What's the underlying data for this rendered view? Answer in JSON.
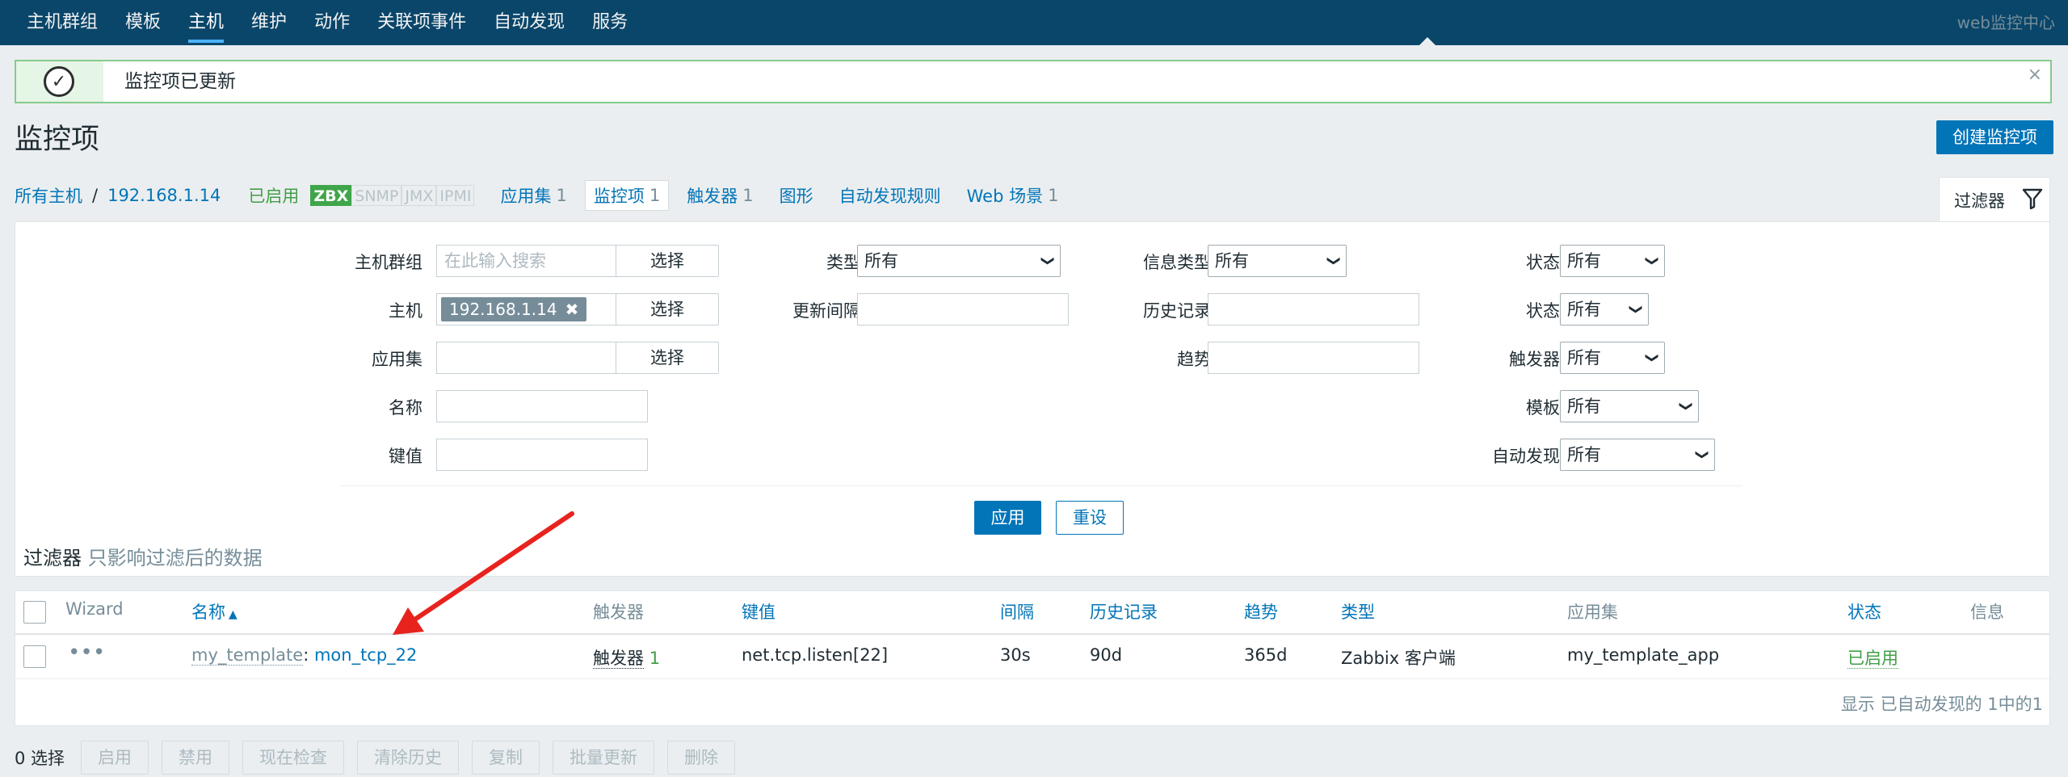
{
  "nav": {
    "items": [
      "主机群组",
      "模板",
      "主机",
      "维护",
      "动作",
      "关联项事件",
      "自动发现",
      "服务"
    ],
    "active_index": 2,
    "site_name": "web监控中心"
  },
  "message": {
    "text": "监控项已更新",
    "close": "×"
  },
  "page": {
    "title": "监控项",
    "create_button": "创建监控项"
  },
  "breadcrumbs": {
    "all_hosts": "所有主机",
    "separator": "/",
    "host": "192.168.1.14",
    "status": "已启用",
    "availability": [
      "ZBX",
      "SNMP",
      "JMX",
      "IPMI"
    ],
    "links": [
      {
        "label": "应用集",
        "count": "1"
      },
      {
        "label": "监控项",
        "count": "1"
      },
      {
        "label": "触发器",
        "count": "1"
      },
      {
        "label": "图形",
        "count": ""
      },
      {
        "label": "自动发现规则",
        "count": ""
      },
      {
        "label": "Web 场景",
        "count": "1"
      }
    ]
  },
  "filter_tab": {
    "label": "过滤器"
  },
  "filter": {
    "host_groups_label": "主机群组",
    "host_groups_placeholder": "在此输入搜索",
    "hosts_label": "主机",
    "host_chip": "192.168.1.14",
    "chip_remove": "✖",
    "application_label": "应用集",
    "name_label": "名称",
    "key_label": "键值",
    "select_button": "选择",
    "type_label": "类型",
    "type_value": "所有",
    "update_interval_label": "更新间隔",
    "info_type_label": "信息类型",
    "info_type_value": "所有",
    "history_label": "历史记录",
    "trends_label": "趋势",
    "state_label": "状态",
    "state_value": "所有",
    "status_label": "状态",
    "status_value": "所有",
    "triggers_label": "触发器",
    "triggers_value": "所有",
    "template_label": "模板",
    "template_value": "所有",
    "discovery_label": "自动发现",
    "discovery_value": "所有",
    "apply_button": "应用",
    "reset_button": "重设",
    "note_bold": "过滤器",
    "note_muted": "只影响过滤后的数据"
  },
  "table": {
    "headers": {
      "wizard": "Wizard",
      "name": "名称",
      "sort_indicator": "▲",
      "triggers": "触发器",
      "key": "键值",
      "interval": "间隔",
      "history": "历史记录",
      "trends": "趋势",
      "type": "类型",
      "applications": "应用集",
      "status": "状态",
      "info": "信息"
    },
    "rows": [
      {
        "wizard": "•••",
        "template": "my_template",
        "name_sep": ":",
        "name": "mon_tcp_22",
        "triggers_label": "触发器",
        "triggers_count": "1",
        "key": "net.tcp.listen[22]",
        "interval": "30s",
        "history": "90d",
        "trends": "365d",
        "type": "Zabbix 客户端",
        "applications": "my_template_app",
        "status": "已启用",
        "info": ""
      }
    ],
    "footer": "显示 已自动发现的 1中的1"
  },
  "actions": {
    "selected": "0 选择",
    "buttons": [
      "启用",
      "禁用",
      "现在检查",
      "清除历史",
      "复制",
      "批量更新",
      "删除"
    ]
  },
  "colors": {
    "nav_bg": "#0a466a",
    "accent": "#0275b8",
    "success": "#429e47",
    "annotation_arrow": "#e8231e"
  }
}
